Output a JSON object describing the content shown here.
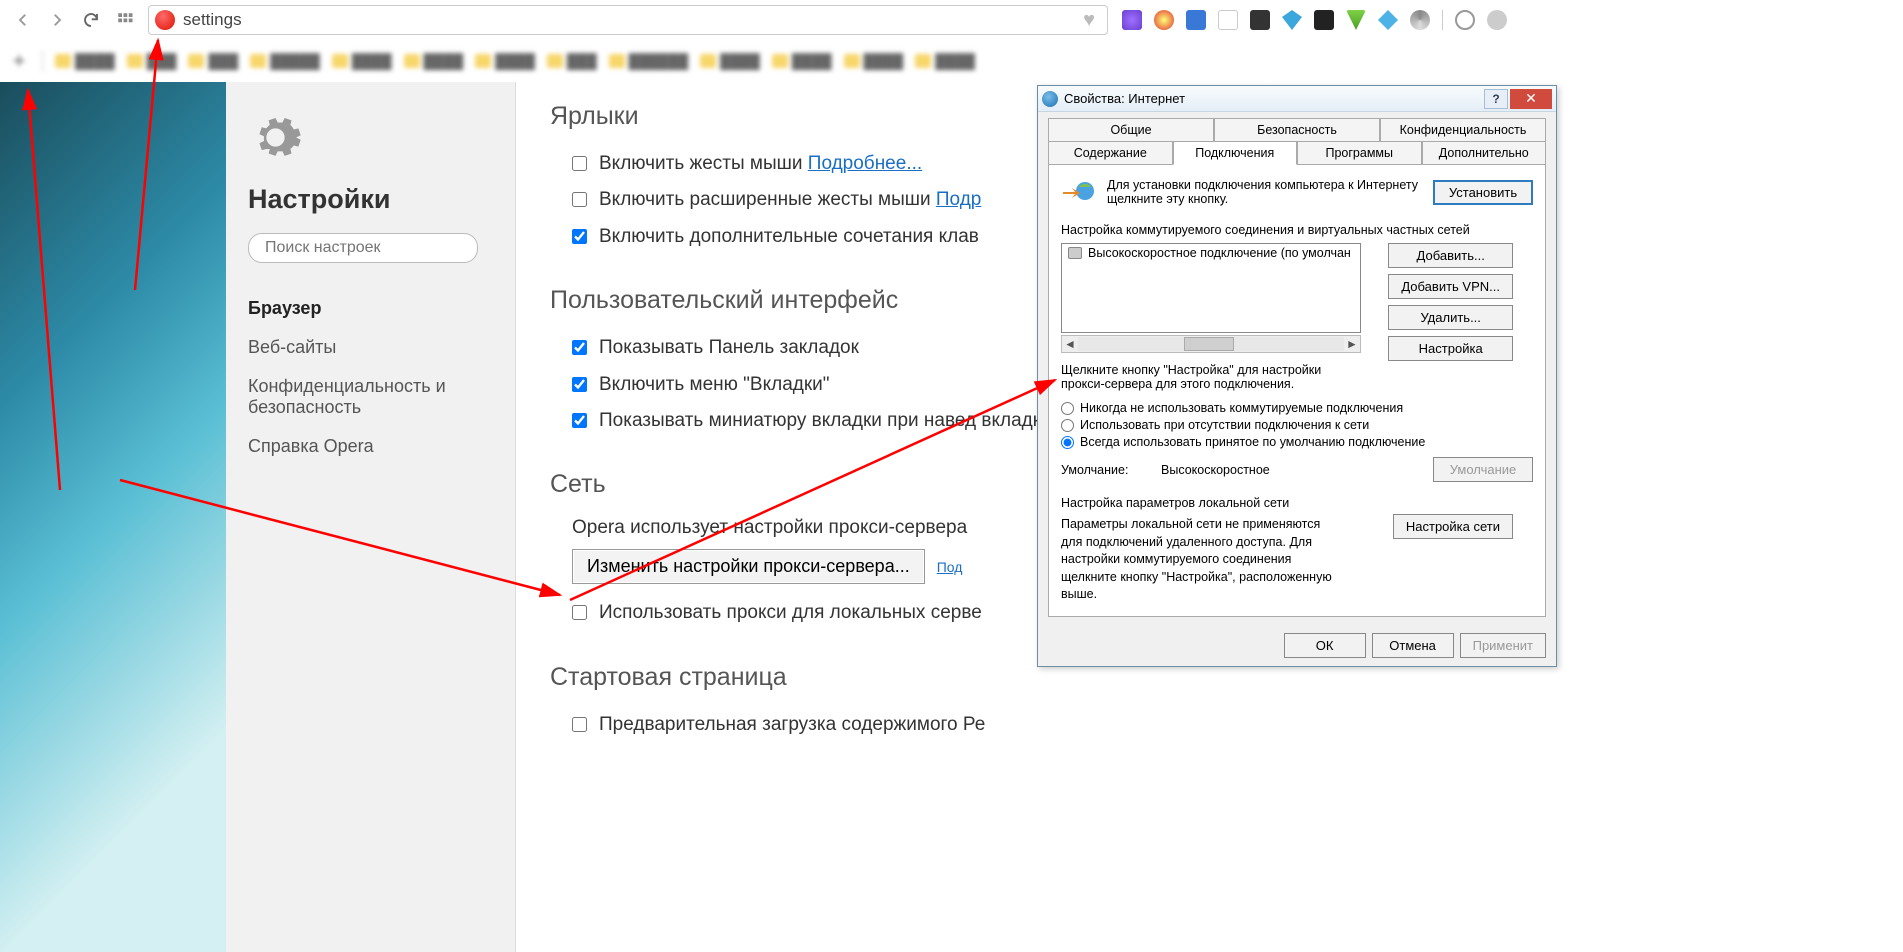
{
  "toolbar": {
    "address_text": "settings"
  },
  "sidebar": {
    "title": "Настройки",
    "search_placeholder": "Поиск настроек",
    "links": [
      "Браузер",
      "Веб-сайты",
      "Конфиденциальность и безопасность",
      "Справка Opera"
    ]
  },
  "sections": {
    "shortcuts": {
      "title": "Ярлыки",
      "opt1": "Включить жесты мыши",
      "opt1_link": "Подробнее...",
      "opt2": "Включить расширенные жесты мыши",
      "opt2_link": "Подр",
      "opt3": "Включить дополнительные сочетания клав"
    },
    "ui": {
      "title": "Пользовательский интерфейс",
      "opt1": "Показывать Панель закладок",
      "opt2": "Включить меню \"Вкладки\"",
      "opt3": "Показывать миниатюру вкладки при навед вкладку"
    },
    "network": {
      "title": "Сеть",
      "desc": "Opera использует настройки прокси-сервера",
      "btn": "Изменить настройки прокси-сервера...",
      "btn_link": "Под",
      "opt1": "Использовать прокси для локальных серве"
    },
    "startpage": {
      "title": "Стартовая страница",
      "opt1": "Предварительная загрузка содержимого Ре"
    }
  },
  "dialog": {
    "title": "Свойства: Интернет",
    "tabs_row1": [
      "Общие",
      "Безопасность",
      "Конфиденциальность"
    ],
    "tabs_row2": [
      "Содержание",
      "Подключения",
      "Программы",
      "Дополнительно"
    ],
    "setup_text": "Для установки подключения компьютера к Интернету щелкните эту кнопку.",
    "setup_btn": "Установить",
    "dial_label": "Настройка коммутируемого соединения и виртуальных частных сетей",
    "conn_item": "Высокоскоростное подключение (по умолчан",
    "btn_add": "Добавить...",
    "btn_add_vpn": "Добавить VPN...",
    "btn_remove": "Удалить...",
    "btn_settings": "Настройка",
    "proxy_hint": "Щелкните кнопку \"Настройка\" для настройки прокси-сервера для этого подключения.",
    "radio1": "Никогда не использовать коммутируемые подключения",
    "radio2": "Использовать при отсутствии подключения к сети",
    "radio3": "Всегда использовать принятое по умолчанию подключение",
    "default_label": "Умолчание:",
    "default_value": "Высокоскоростное",
    "btn_default": "Умолчание",
    "lan_label": "Настройка параметров локальной сети",
    "lan_text": "Параметры локальной сети не применяются для подключений удаленного доступа. Для настройки коммутируемого соединения щелкните кнопку \"Настройка\", расположенную выше.",
    "btn_lan": "Настройка сети",
    "btn_ok": "ОК",
    "btn_cancel": "Отмена",
    "btn_apply": "Применит"
  }
}
